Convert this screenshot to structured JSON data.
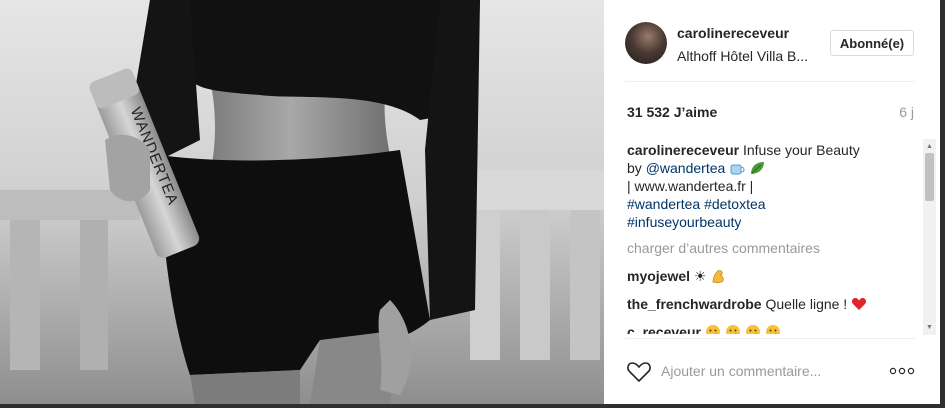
{
  "post": {
    "username": "carolinereceveur",
    "location": "Althoff Hôtel Villa B...",
    "follow_label": "Abonné(e)",
    "likes": "31 532 J’aime",
    "time_ago": "6 j"
  },
  "photo": {
    "bottle_text": "WANDERTEA"
  },
  "caption": {
    "author": "carolinereceveur",
    "line1": "Infuse your Beauty",
    "line2_prefix": "by",
    "mention": "@wandertea",
    "line3": "| www.wandertea.fr |",
    "hashtag1": "#wandertea",
    "hashtag2": "#detoxtea",
    "hashtag3": "#infuseyourbeauty"
  },
  "comments": {
    "load_more": "charger d’autres commentaires",
    "items": [
      {
        "author": "myojewel",
        "text": "☀"
      },
      {
        "author": "the_frenchwardrobe",
        "text": "Quelle ligne !"
      },
      {
        "author": "c_receveur",
        "text": ""
      }
    ]
  },
  "footer": {
    "comment_placeholder": "Ajouter un commentaire...",
    "more_icon": "ellipsis-icon"
  },
  "colors": {
    "link": "#003569",
    "muted": "#999999",
    "text": "#262626"
  }
}
